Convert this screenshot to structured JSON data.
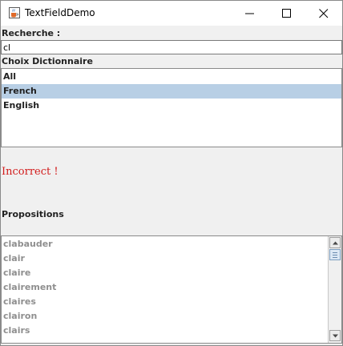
{
  "window": {
    "title": "TextFieldDemo"
  },
  "search": {
    "label": "Recherche :",
    "value": "cl"
  },
  "dictionary": {
    "label": "Choix Dictionnaire",
    "items": [
      "All",
      "French",
      "English"
    ],
    "selected": "French",
    "selected_color": "#b8cfe5"
  },
  "status": {
    "text": "Incorrect !",
    "color": "#d21c1c"
  },
  "propositions": {
    "label": "Propositions",
    "items": [
      "clabauder",
      "clair",
      "claire",
      "clairement",
      "claires",
      "clairon",
      "clairs"
    ]
  }
}
